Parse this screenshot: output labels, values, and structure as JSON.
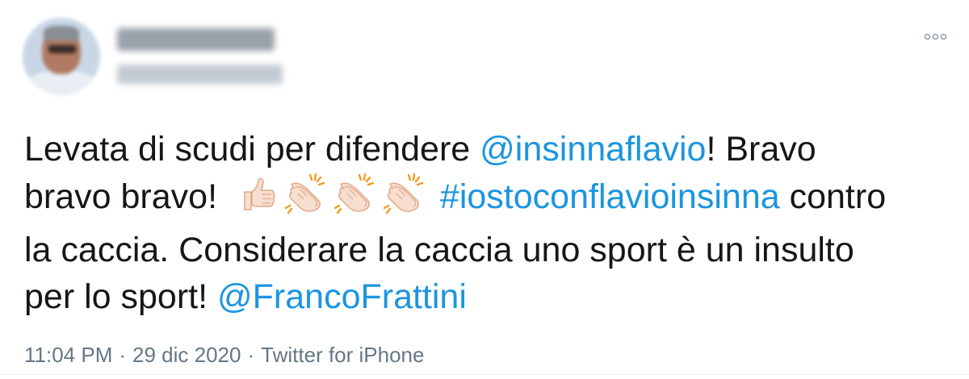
{
  "tweet": {
    "text_line1_a": "Levata di scudi per difendere ",
    "mention1": "@insinnaflavio",
    "text_line1_b": "! Bravo",
    "text_line2_a": "bravo bravo! ",
    "hashtag": "#iostoconflavioinsinna",
    "text_line2_b": " contro",
    "text_line3": "la caccia. Considerare la caccia uno sport è un insulto",
    "text_line4_a": "per lo sport! ",
    "mention2": "@FrancoFrattini",
    "emojis": [
      "thumbs-up-icon",
      "clapping-hands-icon",
      "clapping-hands-icon",
      "clapping-hands-icon"
    ]
  },
  "meta": {
    "time": "11:04 PM",
    "separator": "·",
    "date": "29 dic 2020",
    "source": "Twitter for iPhone"
  },
  "colors": {
    "link": "#1b95e0",
    "text": "#14171a",
    "meta": "#657786",
    "emoji_skin": "#f7dece",
    "emoji_outline": "#e2a98a",
    "clap_lines": "#f79a1f"
  }
}
